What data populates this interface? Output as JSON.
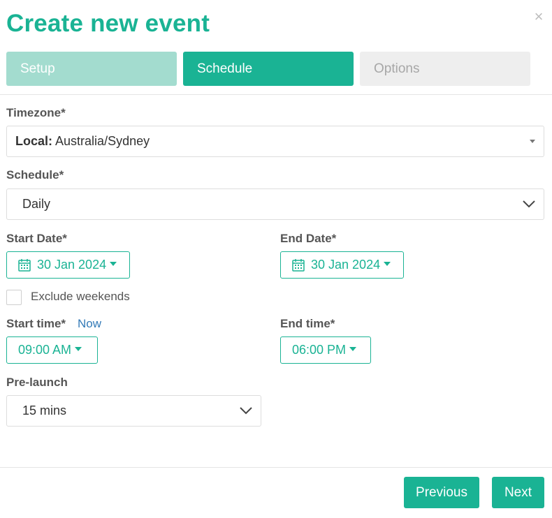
{
  "modal": {
    "title": "Create new event",
    "close_symbol": "×"
  },
  "tabs": [
    {
      "label": "Setup",
      "state": "completed"
    },
    {
      "label": "Schedule",
      "state": "active"
    },
    {
      "label": "Options",
      "state": "disabled"
    }
  ],
  "form": {
    "timezone": {
      "label": "Timezone*",
      "prefix": "Local:",
      "value": "Australia/Sydney"
    },
    "schedule": {
      "label": "Schedule*",
      "value": "Daily"
    },
    "start_date": {
      "label": "Start Date*",
      "value": "30 Jan 2024",
      "icon": "calendar-icon"
    },
    "end_date": {
      "label": "End Date*",
      "value": "30 Jan 2024",
      "icon": "calendar-icon"
    },
    "exclude_weekends": {
      "label": "Exclude weekends",
      "checked": false
    },
    "start_time": {
      "label": "Start time*",
      "now_link": "Now",
      "value": "09:00 AM"
    },
    "end_time": {
      "label": "End time*",
      "value": "06:00 PM"
    },
    "pre_launch": {
      "label": "Pre-launch",
      "value": "15 mins"
    }
  },
  "footer": {
    "previous_label": "Previous",
    "next_label": "Next"
  },
  "colors": {
    "accent": "#1ab394",
    "accent_light": "#a3dccf",
    "disabled_bg": "#eeeeee",
    "link": "#337ab7"
  }
}
